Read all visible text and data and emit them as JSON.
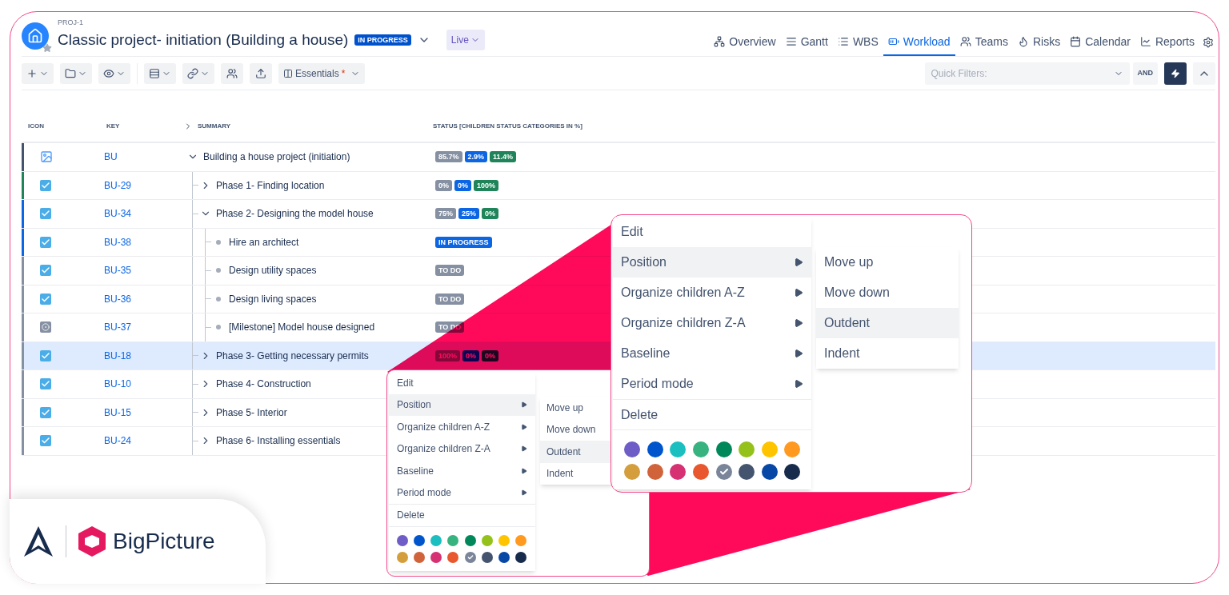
{
  "project": {
    "key": "PROJ-1",
    "title": "Classic project- initiation (Building a house)",
    "status": "IN PROGRESS",
    "view": "Live"
  },
  "nav_tabs": [
    {
      "label": "Overview",
      "selected": false
    },
    {
      "label": "Gantt",
      "selected": false
    },
    {
      "label": "WBS",
      "selected": false
    },
    {
      "label": "Workload",
      "selected": true
    },
    {
      "label": "Teams",
      "selected": false
    },
    {
      "label": "Risks",
      "selected": false
    },
    {
      "label": "Calendar",
      "selected": false
    },
    {
      "label": "Reports",
      "selected": false
    }
  ],
  "toolbar": {
    "view_preset": "Essentials",
    "modified_mark": "*",
    "quick_filters": {
      "placeholder": "Quick Filters:"
    },
    "operator": "AND"
  },
  "table": {
    "columns": [
      "ICON",
      "KEY",
      "SUMMARY",
      "STATUS [CHILDREN STATUS CATEGORIES IN %]"
    ],
    "rows": [
      {
        "kind": "project",
        "key": "BU",
        "summary": "Building a house project (initiation)",
        "color": "#44546f",
        "expanded": true,
        "selected": false,
        "status": [
          {
            "text": "85.7%",
            "kind": "todo"
          },
          {
            "text": "2.9%",
            "kind": "progress"
          },
          {
            "text": "11.4%",
            "kind": "done"
          }
        ],
        "children": [
          {
            "kind": "task",
            "key": "BU-29",
            "summary": "Phase 1- Finding location",
            "color": "#1f845a",
            "expanded": false,
            "selected": false,
            "status": [
              {
                "text": "0%",
                "kind": "todo"
              },
              {
                "text": "0%",
                "kind": "progress"
              },
              {
                "text": "100%",
                "kind": "done"
              }
            ]
          },
          {
            "kind": "task",
            "key": "BU-34",
            "summary": "Phase 2- Designing the model house",
            "color": "#0c66e4",
            "expanded": true,
            "selected": false,
            "status": [
              {
                "text": "75%",
                "kind": "todo"
              },
              {
                "text": "25%",
                "kind": "progress"
              },
              {
                "text": "0%",
                "kind": "done"
              }
            ],
            "children": [
              {
                "kind": "task",
                "key": "BU-38",
                "summary": "Hire an architect",
                "color": "#0c66e4",
                "selected": false,
                "status": [
                  {
                    "text": "IN PROGRESS",
                    "kind": "progress"
                  }
                ]
              },
              {
                "kind": "task",
                "key": "BU-35",
                "summary": "Design utility spaces",
                "color": "#8590a2",
                "selected": false,
                "status": [
                  {
                    "text": "TO DO",
                    "kind": "todo"
                  }
                ]
              },
              {
                "kind": "task",
                "key": "BU-36",
                "summary": "Design living spaces",
                "color": "#8590a2",
                "selected": false,
                "status": [
                  {
                    "text": "TO DO",
                    "kind": "todo"
                  }
                ]
              },
              {
                "kind": "milestone",
                "key": "BU-37",
                "summary": "[Milestone] Model house designed",
                "color": "#8590a2",
                "selected": false,
                "status": [
                  {
                    "text": "TO DO",
                    "kind": "todo"
                  }
                ]
              }
            ]
          },
          {
            "kind": "task",
            "key": "BU-18",
            "summary": "Phase 3- Getting necessary permits",
            "color": "#8590a2",
            "expanded": false,
            "selected": true,
            "status": [
              {
                "text": "100%",
                "kind": "todo"
              },
              {
                "text": "0%",
                "kind": "progress"
              },
              {
                "text": "0%",
                "kind": "done"
              }
            ]
          },
          {
            "kind": "task",
            "key": "BU-10",
            "summary": "Phase 4- Construction",
            "color": "#8590a2",
            "expanded": false,
            "selected": false
          },
          {
            "kind": "task",
            "key": "BU-15",
            "summary": "Phase 5- Interior",
            "color": "#8590a2",
            "expanded": false,
            "selected": false
          },
          {
            "kind": "task",
            "key": "BU-24",
            "summary": "Phase 6- Installing essentials",
            "color": "#8590a2",
            "expanded": false,
            "selected": false
          }
        ]
      }
    ]
  },
  "context_menu": {
    "items": [
      {
        "label": "Edit",
        "submenu": false,
        "selected": false
      },
      {
        "label": "Position",
        "submenu": true,
        "selected": true
      },
      {
        "label": "Organize children A-Z",
        "submenu": true,
        "selected": false
      },
      {
        "label": "Organize children Z-A",
        "submenu": true,
        "selected": false
      },
      {
        "label": "Baseline",
        "submenu": true,
        "selected": false
      },
      {
        "label": "Period mode",
        "submenu": true,
        "selected": false
      },
      {
        "label": "Delete",
        "submenu": false,
        "selected": false
      }
    ],
    "submenu": [
      {
        "label": "Move up",
        "selected": false
      },
      {
        "label": "Move down",
        "selected": false
      },
      {
        "label": "Outdent",
        "selected": true
      },
      {
        "label": "Indent",
        "selected": false
      }
    ],
    "colors": [
      {
        "color": "#6e5dc6",
        "selected": false
      },
      {
        "color": "#0055cc",
        "selected": false
      },
      {
        "color": "#1bbfbf",
        "selected": false
      },
      {
        "color": "#36b37e",
        "selected": false
      },
      {
        "color": "#00875a",
        "selected": false
      },
      {
        "color": "#94c11a",
        "selected": false
      },
      {
        "color": "#ffc400",
        "selected": false
      },
      {
        "color": "#ff991f",
        "selected": false
      },
      {
        "color": "#d49e3c",
        "selected": false
      },
      {
        "color": "#d0633a",
        "selected": false
      },
      {
        "color": "#d63172",
        "selected": false
      },
      {
        "color": "#e8572d",
        "selected": false
      },
      {
        "color": "#7a8599",
        "selected": true
      },
      {
        "color": "#44546f",
        "selected": false
      },
      {
        "color": "#0747a6",
        "selected": false
      },
      {
        "color": "#172b4d",
        "selected": false
      }
    ]
  },
  "magnified_menu": {
    "items": [
      {
        "label": "Edit",
        "submenu": false,
        "selected": false
      },
      {
        "label": "Position",
        "submenu": true,
        "selected": true
      },
      {
        "label": "Organize children A-Z",
        "submenu": true,
        "selected": false
      },
      {
        "label": "Organize children Z-A",
        "submenu": true,
        "selected": false
      },
      {
        "label": "Baseline",
        "submenu": true,
        "selected": false
      },
      {
        "label": "Period mode",
        "submenu": true,
        "selected": false
      },
      {
        "label": "Delete",
        "submenu": false,
        "selected": false
      }
    ],
    "submenu": [
      {
        "label": "Move up",
        "selected": false
      },
      {
        "label": "Move down",
        "selected": false
      },
      {
        "label": "Outdent",
        "selected": true
      },
      {
        "label": "Indent",
        "selected": false
      }
    ],
    "colors": [
      {
        "color": "#6e5dc6",
        "selected": false
      },
      {
        "color": "#0055cc",
        "selected": false
      },
      {
        "color": "#1bbfbf",
        "selected": false
      },
      {
        "color": "#36b37e",
        "selected": false
      },
      {
        "color": "#00875a",
        "selected": false
      },
      {
        "color": "#94c11a",
        "selected": false
      },
      {
        "color": "#ffc400",
        "selected": false
      },
      {
        "color": "#ff991f",
        "selected": false
      },
      {
        "color": "#d49e3c",
        "selected": false
      },
      {
        "color": "#d0633a",
        "selected": false
      },
      {
        "color": "#d63172",
        "selected": false
      },
      {
        "color": "#e8572d",
        "selected": false
      },
      {
        "color": "#7a8599",
        "selected": true
      },
      {
        "color": "#44546f",
        "selected": false
      },
      {
        "color": "#0747a6",
        "selected": false
      },
      {
        "color": "#172b4d",
        "selected": false
      }
    ]
  },
  "brand": {
    "name": "BigPicture"
  }
}
